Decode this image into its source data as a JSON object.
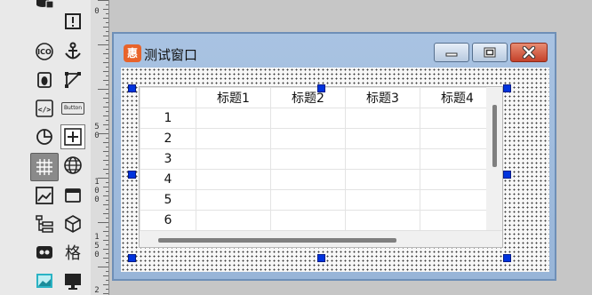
{
  "toolbox": {
    "tools": [
      {
        "name": "database-icon"
      },
      {
        "name": "warning-icon"
      },
      {
        "name": "ico-icon"
      },
      {
        "name": "anchor-icon"
      },
      {
        "name": "bug-icon"
      },
      {
        "name": "polygon-edit-icon"
      },
      {
        "name": "code-icon"
      },
      {
        "name": "button-icon",
        "label": "Button"
      },
      {
        "name": "pie-chart-icon"
      },
      {
        "name": "add-box-icon"
      },
      {
        "name": "grid-icon"
      },
      {
        "name": "globe-icon"
      },
      {
        "name": "image-icon"
      },
      {
        "name": "window-icon"
      },
      {
        "name": "tree-list-icon"
      },
      {
        "name": "cube-icon"
      },
      {
        "name": "mask-icon"
      },
      {
        "name": "grid-char-icon",
        "label": "格"
      },
      {
        "name": "picture-icon"
      },
      {
        "name": "monitor-icon"
      }
    ],
    "selected": "grid-icon"
  },
  "ruler": {
    "labels": [
      "0",
      "50",
      "100",
      "150",
      "2"
    ]
  },
  "window": {
    "title": "测试窗口",
    "icon_label": "惠",
    "controls": [
      "minimize",
      "maximize",
      "close"
    ]
  },
  "grid": {
    "columns": [
      "",
      "标题1",
      "标题2",
      "标题3",
      "标题4"
    ],
    "rows": [
      "1",
      "2",
      "3",
      "4",
      "5",
      "6"
    ],
    "vertical_scrollbar": true,
    "horizontal_scrollbar": true
  },
  "colors": {
    "selection_handle": "#0033dd",
    "window_frame": "#a9c3e2",
    "close_button": "#c4412a"
  }
}
